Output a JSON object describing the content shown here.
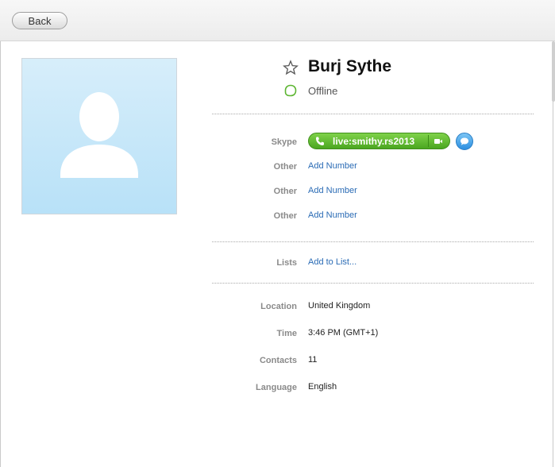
{
  "toolbar": {
    "back_label": "Back"
  },
  "profile": {
    "name": "Burj Sythe",
    "status": "Offline",
    "status_color": "#5cb531"
  },
  "phones": {
    "skype_label": "Skype",
    "skype_id": "live:smithy.rs2013",
    "rows": [
      {
        "label": "Other",
        "action": "Add Number"
      },
      {
        "label": "Other",
        "action": "Add Number"
      },
      {
        "label": "Other",
        "action": "Add Number"
      }
    ]
  },
  "lists": {
    "label": "Lists",
    "action": "Add to List..."
  },
  "details": [
    {
      "label": "Location",
      "value": "United Kingdom"
    },
    {
      "label": "Time",
      "value": "3:46 PM (GMT+1)"
    },
    {
      "label": "Contacts",
      "value": "11"
    },
    {
      "label": "Language",
      "value": "English"
    }
  ],
  "colors": {
    "link": "#2a6bb5",
    "call_green": "#4ba620",
    "chat_blue": "#2c8fe0"
  }
}
